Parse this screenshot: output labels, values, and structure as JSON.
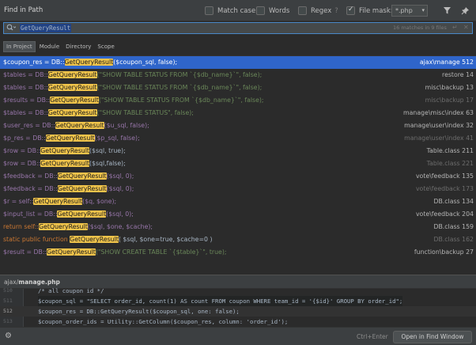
{
  "window": {
    "title": "Find in Path"
  },
  "options": {
    "match_case": "Match case",
    "words": "Words",
    "regex": "Regex",
    "regex_help": "?",
    "file_mask_label": "File mask:",
    "file_mask_value": "*.php"
  },
  "search": {
    "query": "GetQueryResult",
    "count": "16 matches in 9 files"
  },
  "scopes": [
    "In Project",
    "Module",
    "Directory",
    "Scope"
  ],
  "results": [
    {
      "pre": "$coupon_res = DB::",
      "match": "GetQueryResult",
      "post": "($coupon_sql, false);",
      "file": "ajax\\manage",
      "line": "512"
    },
    {
      "pre": "$tables = DB::",
      "match": "GetQueryResult",
      "post": "(\"SHOW TABLE STATUS FROM `{$db_name}`\", false);",
      "file": "restore",
      "line": "14"
    },
    {
      "pre": "$tables = DB::",
      "match": "GetQueryResult",
      "post": "(\"SHOW TABLE STATUS FROM `{$db_name}`\", false);",
      "file": "misc\\backup",
      "line": "13"
    },
    {
      "pre": "$results = DB::",
      "match": "GetQueryResult",
      "post": "(\"SHOW TABLE STATUS FROM `{$db_name}`\", false);",
      "file": "misc\\backup",
      "line": "17"
    },
    {
      "pre": "$tables = DB::",
      "match": "GetQueryResult",
      "post": "(\"SHOW TABLE STATUS\", false);",
      "file": "manage\\misc\\index",
      "line": "63"
    },
    {
      "pre": "$user_res = DB::",
      "match": "GetQueryResult",
      "post": "($u_sql, false);",
      "file": "manage\\user\\index",
      "line": "32"
    },
    {
      "pre": "$p_res = DB::",
      "match": "GetQueryResult",
      "post": "($p_sql, false);",
      "file": "manage\\user\\index",
      "line": "41"
    },
    {
      "pre": "$row = DB::",
      "match": "GetQueryResult",
      "post": "($sql, true);",
      "file": "Table.class",
      "line": "211"
    },
    {
      "pre": "$row = DB::",
      "match": "GetQueryResult",
      "post": "($sql,false);",
      "file": "Table.class",
      "line": "221"
    },
    {
      "pre": "$feedback = DB::",
      "match": "GetQueryResult",
      "post": "($sql, 0);",
      "file": "vote\\feedback",
      "line": "135"
    },
    {
      "pre": "$feedback = DB::",
      "match": "GetQueryResult",
      "post": "($sql, 0);",
      "file": "vote\\feedback",
      "line": "173"
    },
    {
      "pre": "$r = self::",
      "match": "GetQueryResult",
      "post": "($q, $one);",
      "file": "DB.class",
      "line": "134"
    },
    {
      "pre": "$input_list = DB::",
      "match": "GetQueryResult",
      "post": "($sql, 0);",
      "file": "vote\\feedback",
      "line": "204"
    },
    {
      "pre": "return self::",
      "match": "GetQueryResult",
      "post": "($sql, $one, $cache);",
      "file": "DB.class",
      "line": "159"
    },
    {
      "pre": "static public function ",
      "match": "GetQueryResult",
      "post": "( $sql, $one=true, $cache=0 )",
      "file": "DB.class",
      "line": "162"
    },
    {
      "pre": "$result = DB::",
      "match": "GetQueryResult",
      "post": "(\"SHOW CREATE TABLE `{$table}`\", true);",
      "file": "function\\backup",
      "line": "27"
    }
  ],
  "preview": {
    "path_dir": "ajax/",
    "path_file": "manage.php",
    "lines": [
      {
        "no": "510",
        "text": "/* all coupon id */"
      },
      {
        "no": "511",
        "text": "$coupon_sql = \"SELECT order_id, count(1) AS count FROM coupon WHERE team_id = '{$id}' GROUP BY order_id\";"
      },
      {
        "no": "512",
        "text": "$coupon_res = DB::GetQueryResult($coupon_sql, one: false);"
      },
      {
        "no": "513",
        "text": "$coupon_order_ids = Utility::GetColumn($coupon_res, column: 'order_id');"
      }
    ]
  },
  "footer": {
    "shortcut": "Ctrl+Enter",
    "open_button": "Open in Find Window"
  },
  "colors": {
    "selection": "#2f65ca",
    "match_highlight": "#f0c44b",
    "background": "#2b2b2b",
    "panel": "#3c3f41"
  }
}
